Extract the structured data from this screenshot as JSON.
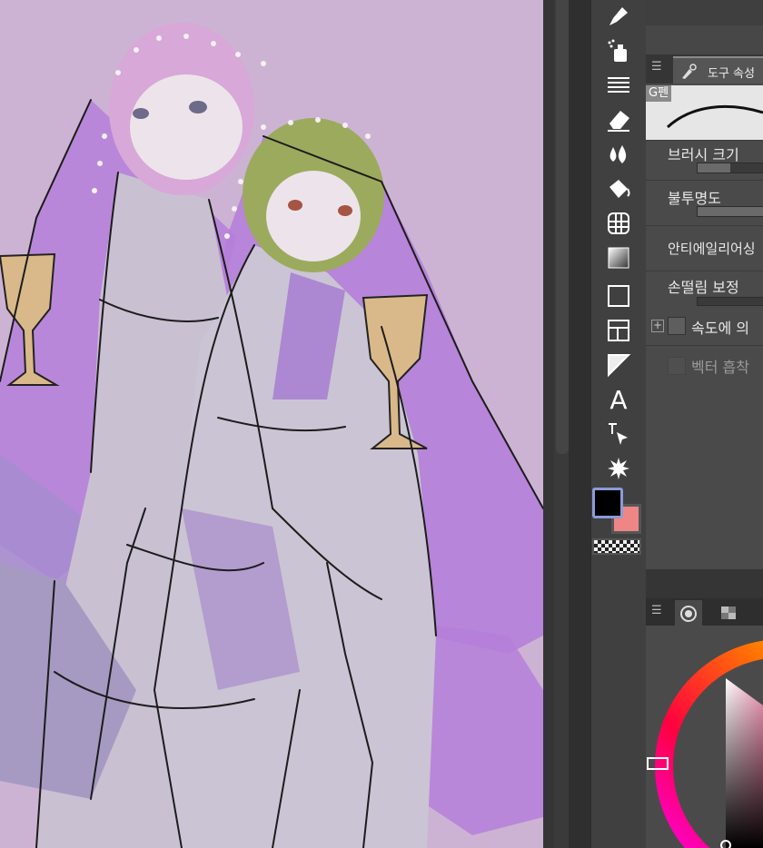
{
  "tool_property_panel": {
    "tab_label": "도구 속성",
    "brush_name": "G펜",
    "properties": [
      {
        "label": "브러시 크기"
      },
      {
        "label": "불투명도"
      },
      {
        "label": "안티에일리어싱"
      },
      {
        "label": "손떨림 보정"
      },
      {
        "label": "속도에 의"
      },
      {
        "label": "벡터 흡착"
      }
    ]
  },
  "toolbar": {
    "tools": [
      "pen-icon",
      "airbrush-icon",
      "blend-icon",
      "eraser-icon",
      "fill-drops-icon",
      "paint-bucket-icon",
      "gradient-mesh-icon",
      "gradient-icon",
      "frame-icon",
      "layout-icon",
      "ruler-icon",
      "text-icon",
      "object-select-icon",
      "sparkle-icon"
    ],
    "text_tool_glyph": "A"
  },
  "colors": {
    "main": "#000000",
    "sub": "#ef8686",
    "canvas_bg": "#cdb3d3",
    "accent_purple": "#b57fd9"
  },
  "palette_tabs": [
    "color-wheel-tab",
    "color-set-tab"
  ]
}
